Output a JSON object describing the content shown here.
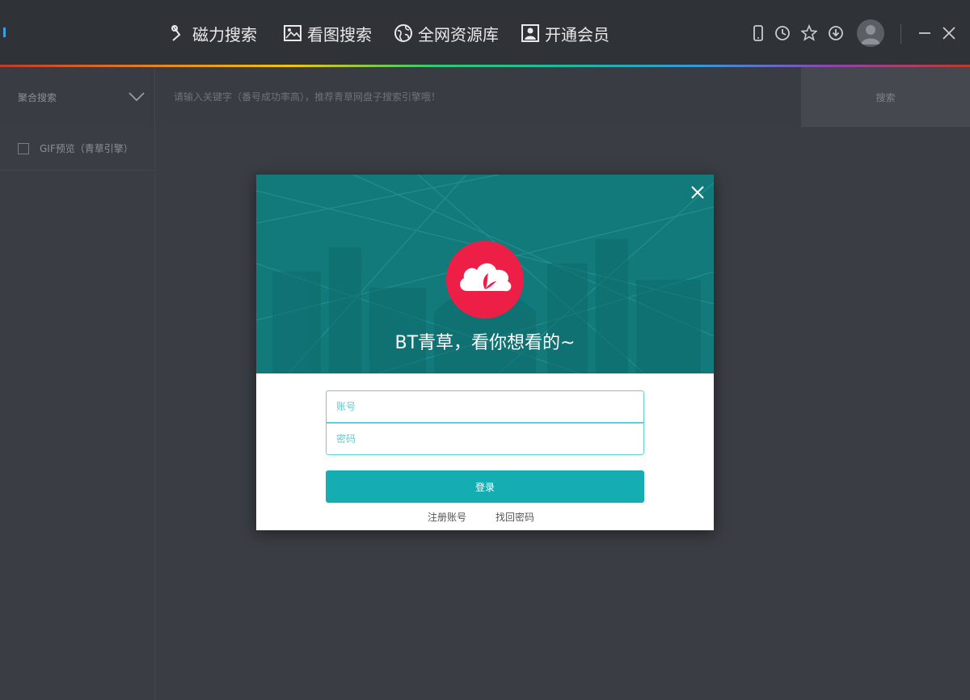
{
  "nav": {
    "items": [
      {
        "label": "磁力搜索",
        "icon": "magnet-search-icon"
      },
      {
        "label": "看图搜索",
        "icon": "image-search-icon"
      },
      {
        "label": "全网资源库",
        "icon": "globe-icon"
      },
      {
        "label": "开通会员",
        "icon": "member-card-icon"
      }
    ]
  },
  "toolbar": {
    "icons": [
      "mobile-icon",
      "history-clock-icon",
      "favorite-star-icon",
      "download-icon",
      "user-avatar",
      "minimize-icon",
      "close-icon"
    ]
  },
  "search": {
    "mode_label": "聚合搜索",
    "placeholder": "请输入关键字（番号成功率高），推荐青草网盘子搜索引擎哦！",
    "button_label": "搜索"
  },
  "sidebar": {
    "gif_preview_label": "GIF预览（青草引擎）",
    "gif_preview_checked": false
  },
  "login_dialog": {
    "slogan": "BT青草，看你想看的~",
    "account_placeholder": "账号",
    "password_placeholder": "密码",
    "login_button": "登录",
    "register_link": "注册账号",
    "forgot_link": "找回密码",
    "header_color": "#137a7c",
    "logo_color": "#ee1f47",
    "accent_color": "#14adb2"
  }
}
